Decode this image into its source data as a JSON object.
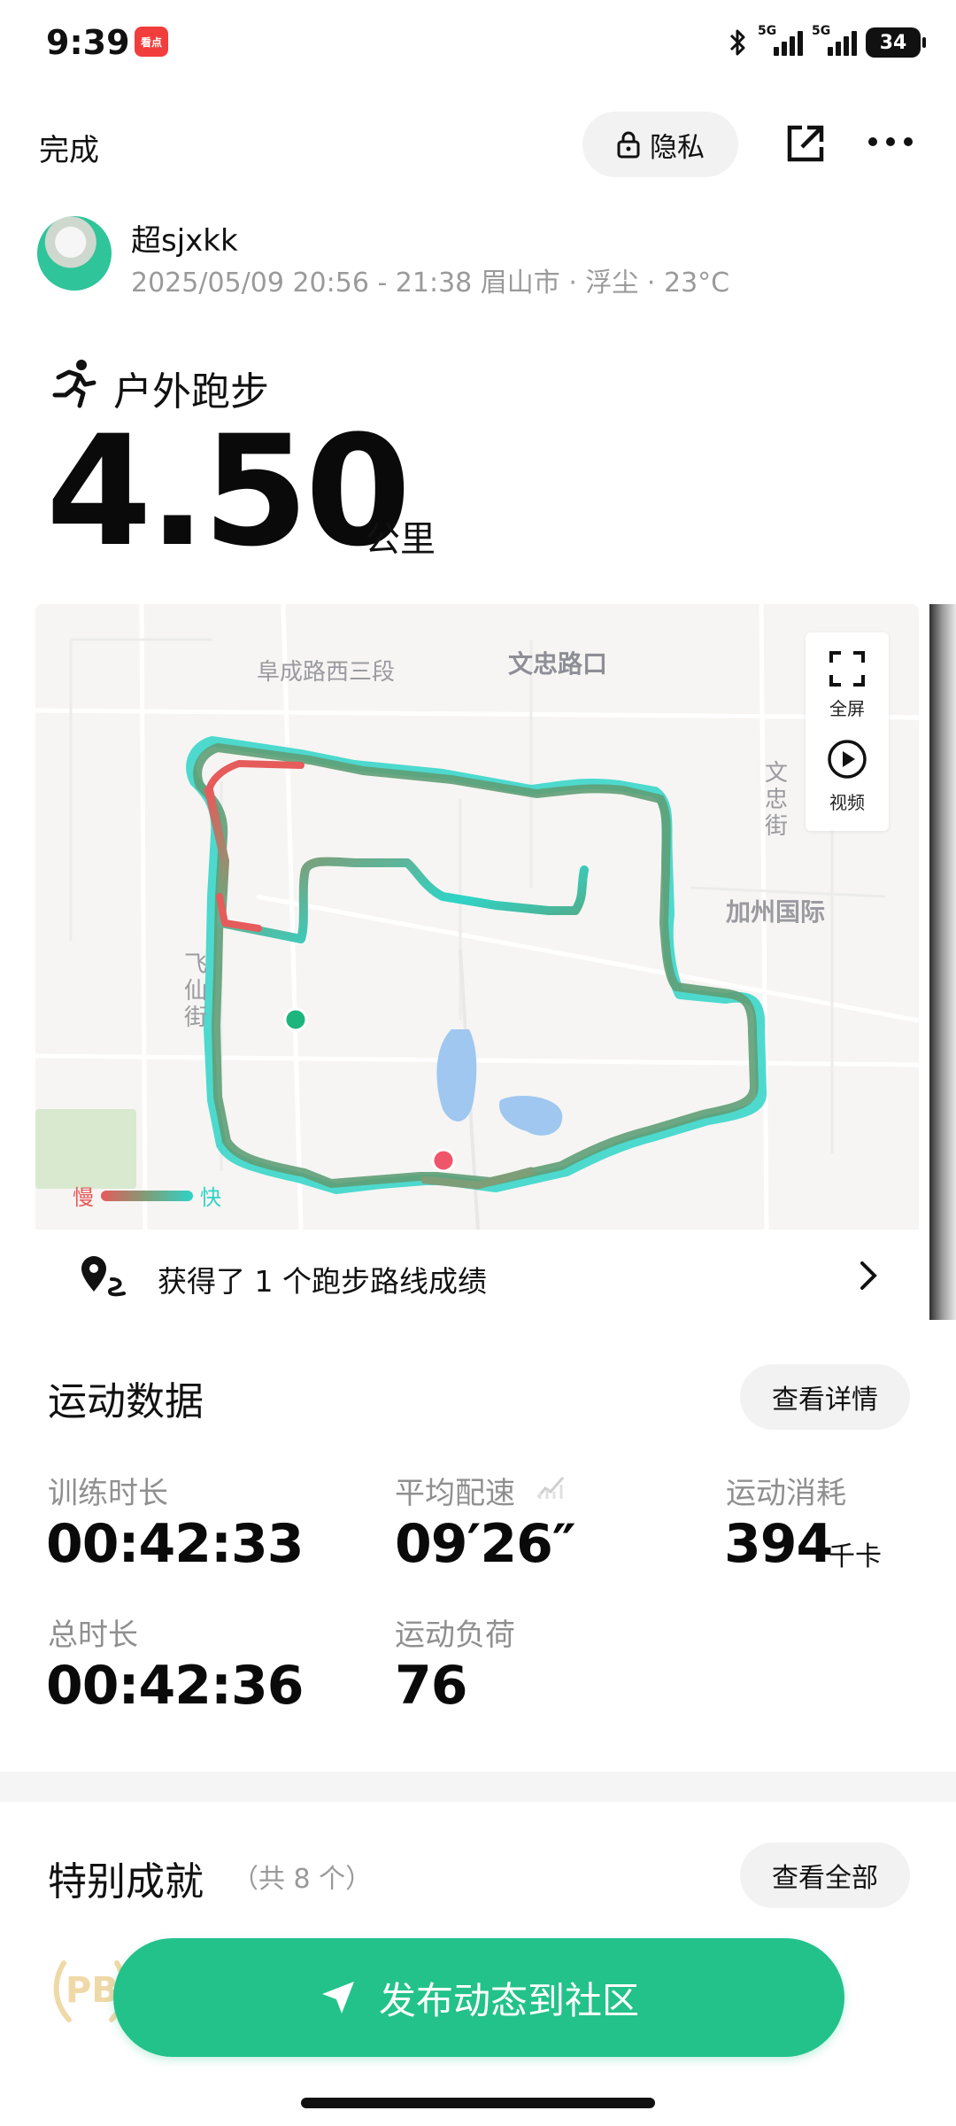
{
  "status_bar": {
    "time": "9:39",
    "app_badge": "看点",
    "signal1_label": "5G",
    "signal2_label": "5G",
    "battery": "34"
  },
  "header": {
    "done_label": "完成",
    "privacy_label": "隐私"
  },
  "user": {
    "name": "超sjxkk",
    "meta": "2025/05/09 20:56 - 21:38 眉山市 · 浮尘 · 23°C"
  },
  "activity": {
    "type": "户外跑步",
    "distance": "4.50",
    "distance_unit": "公里"
  },
  "map": {
    "labels": {
      "road1": "阜成路西三段",
      "road2": "文忠路口",
      "street_right": "文忠街",
      "area": "加州国际",
      "street_left": "飞仙街"
    },
    "controls": {
      "fullscreen": "全屏",
      "video": "视频"
    },
    "legend": {
      "slow": "慢",
      "fast": "快"
    },
    "route_achievement": "获得了 1 个跑步路线成绩",
    "colors": {
      "slow": "#e65b5b",
      "fast": "#2fd4c7",
      "start": "#1db57e",
      "end": "#f0566a"
    }
  },
  "stats": {
    "title": "运动数据",
    "details_button": "查看详情",
    "items": [
      {
        "label": "训练时长",
        "value": "00:42:33",
        "unit": ""
      },
      {
        "label": "平均配速",
        "value": "09′26″",
        "unit": ""
      },
      {
        "label": "运动消耗",
        "value": "394",
        "unit": "千卡"
      },
      {
        "label": "总时长",
        "value": "00:42:36",
        "unit": ""
      },
      {
        "label": "运动负荷",
        "value": "76",
        "unit": ""
      }
    ]
  },
  "achievements": {
    "title": "特别成就",
    "count": "（共 8 个）",
    "view_all_button": "查看全部",
    "badge_text": "PB"
  },
  "publish_button": "发布动态到社区",
  "accent_color": "#23c28a"
}
